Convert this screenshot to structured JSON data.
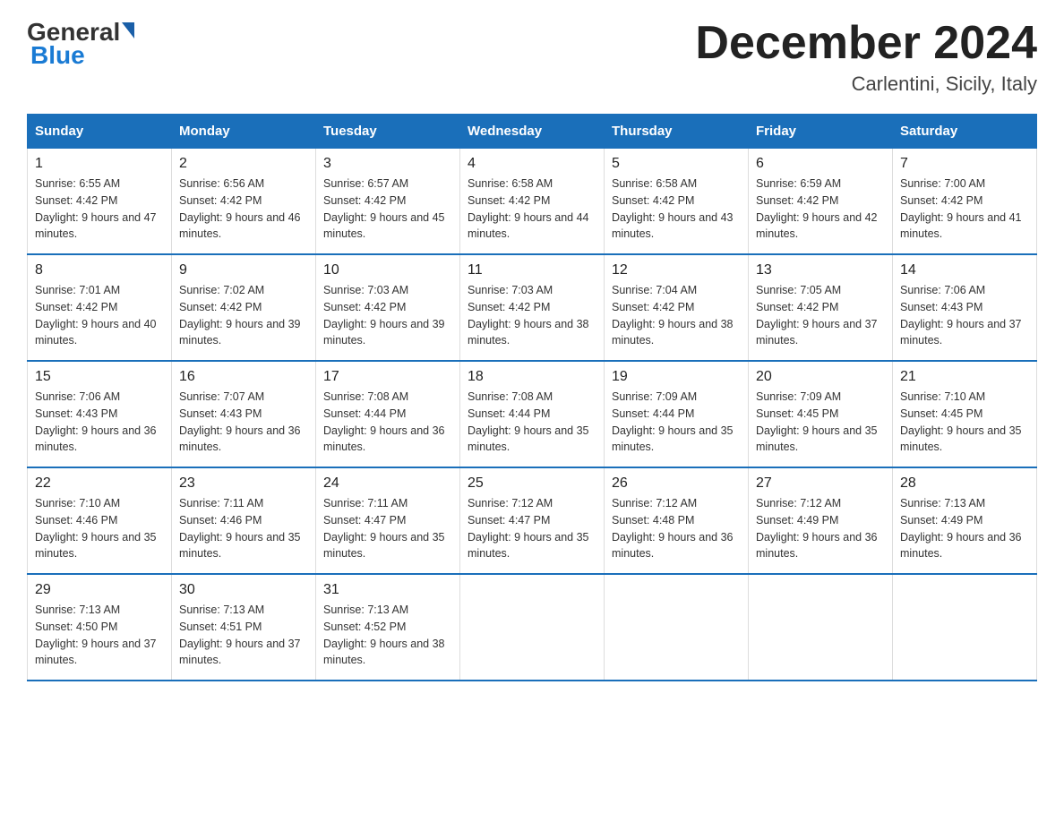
{
  "header": {
    "logo_general": "General",
    "logo_blue": "Blue",
    "month_title": "December 2024",
    "location": "Carlentini, Sicily, Italy"
  },
  "weekdays": [
    "Sunday",
    "Monday",
    "Tuesday",
    "Wednesday",
    "Thursday",
    "Friday",
    "Saturday"
  ],
  "weeks": [
    [
      {
        "day": "1",
        "sunrise": "Sunrise: 6:55 AM",
        "sunset": "Sunset: 4:42 PM",
        "daylight": "Daylight: 9 hours and 47 minutes."
      },
      {
        "day": "2",
        "sunrise": "Sunrise: 6:56 AM",
        "sunset": "Sunset: 4:42 PM",
        "daylight": "Daylight: 9 hours and 46 minutes."
      },
      {
        "day": "3",
        "sunrise": "Sunrise: 6:57 AM",
        "sunset": "Sunset: 4:42 PM",
        "daylight": "Daylight: 9 hours and 45 minutes."
      },
      {
        "day": "4",
        "sunrise": "Sunrise: 6:58 AM",
        "sunset": "Sunset: 4:42 PM",
        "daylight": "Daylight: 9 hours and 44 minutes."
      },
      {
        "day": "5",
        "sunrise": "Sunrise: 6:58 AM",
        "sunset": "Sunset: 4:42 PM",
        "daylight": "Daylight: 9 hours and 43 minutes."
      },
      {
        "day": "6",
        "sunrise": "Sunrise: 6:59 AM",
        "sunset": "Sunset: 4:42 PM",
        "daylight": "Daylight: 9 hours and 42 minutes."
      },
      {
        "day": "7",
        "sunrise": "Sunrise: 7:00 AM",
        "sunset": "Sunset: 4:42 PM",
        "daylight": "Daylight: 9 hours and 41 minutes."
      }
    ],
    [
      {
        "day": "8",
        "sunrise": "Sunrise: 7:01 AM",
        "sunset": "Sunset: 4:42 PM",
        "daylight": "Daylight: 9 hours and 40 minutes."
      },
      {
        "day": "9",
        "sunrise": "Sunrise: 7:02 AM",
        "sunset": "Sunset: 4:42 PM",
        "daylight": "Daylight: 9 hours and 39 minutes."
      },
      {
        "day": "10",
        "sunrise": "Sunrise: 7:03 AM",
        "sunset": "Sunset: 4:42 PM",
        "daylight": "Daylight: 9 hours and 39 minutes."
      },
      {
        "day": "11",
        "sunrise": "Sunrise: 7:03 AM",
        "sunset": "Sunset: 4:42 PM",
        "daylight": "Daylight: 9 hours and 38 minutes."
      },
      {
        "day": "12",
        "sunrise": "Sunrise: 7:04 AM",
        "sunset": "Sunset: 4:42 PM",
        "daylight": "Daylight: 9 hours and 38 minutes."
      },
      {
        "day": "13",
        "sunrise": "Sunrise: 7:05 AM",
        "sunset": "Sunset: 4:42 PM",
        "daylight": "Daylight: 9 hours and 37 minutes."
      },
      {
        "day": "14",
        "sunrise": "Sunrise: 7:06 AM",
        "sunset": "Sunset: 4:43 PM",
        "daylight": "Daylight: 9 hours and 37 minutes."
      }
    ],
    [
      {
        "day": "15",
        "sunrise": "Sunrise: 7:06 AM",
        "sunset": "Sunset: 4:43 PM",
        "daylight": "Daylight: 9 hours and 36 minutes."
      },
      {
        "day": "16",
        "sunrise": "Sunrise: 7:07 AM",
        "sunset": "Sunset: 4:43 PM",
        "daylight": "Daylight: 9 hours and 36 minutes."
      },
      {
        "day": "17",
        "sunrise": "Sunrise: 7:08 AM",
        "sunset": "Sunset: 4:44 PM",
        "daylight": "Daylight: 9 hours and 36 minutes."
      },
      {
        "day": "18",
        "sunrise": "Sunrise: 7:08 AM",
        "sunset": "Sunset: 4:44 PM",
        "daylight": "Daylight: 9 hours and 35 minutes."
      },
      {
        "day": "19",
        "sunrise": "Sunrise: 7:09 AM",
        "sunset": "Sunset: 4:44 PM",
        "daylight": "Daylight: 9 hours and 35 minutes."
      },
      {
        "day": "20",
        "sunrise": "Sunrise: 7:09 AM",
        "sunset": "Sunset: 4:45 PM",
        "daylight": "Daylight: 9 hours and 35 minutes."
      },
      {
        "day": "21",
        "sunrise": "Sunrise: 7:10 AM",
        "sunset": "Sunset: 4:45 PM",
        "daylight": "Daylight: 9 hours and 35 minutes."
      }
    ],
    [
      {
        "day": "22",
        "sunrise": "Sunrise: 7:10 AM",
        "sunset": "Sunset: 4:46 PM",
        "daylight": "Daylight: 9 hours and 35 minutes."
      },
      {
        "day": "23",
        "sunrise": "Sunrise: 7:11 AM",
        "sunset": "Sunset: 4:46 PM",
        "daylight": "Daylight: 9 hours and 35 minutes."
      },
      {
        "day": "24",
        "sunrise": "Sunrise: 7:11 AM",
        "sunset": "Sunset: 4:47 PM",
        "daylight": "Daylight: 9 hours and 35 minutes."
      },
      {
        "day": "25",
        "sunrise": "Sunrise: 7:12 AM",
        "sunset": "Sunset: 4:47 PM",
        "daylight": "Daylight: 9 hours and 35 minutes."
      },
      {
        "day": "26",
        "sunrise": "Sunrise: 7:12 AM",
        "sunset": "Sunset: 4:48 PM",
        "daylight": "Daylight: 9 hours and 36 minutes."
      },
      {
        "day": "27",
        "sunrise": "Sunrise: 7:12 AM",
        "sunset": "Sunset: 4:49 PM",
        "daylight": "Daylight: 9 hours and 36 minutes."
      },
      {
        "day": "28",
        "sunrise": "Sunrise: 7:13 AM",
        "sunset": "Sunset: 4:49 PM",
        "daylight": "Daylight: 9 hours and 36 minutes."
      }
    ],
    [
      {
        "day": "29",
        "sunrise": "Sunrise: 7:13 AM",
        "sunset": "Sunset: 4:50 PM",
        "daylight": "Daylight: 9 hours and 37 minutes."
      },
      {
        "day": "30",
        "sunrise": "Sunrise: 7:13 AM",
        "sunset": "Sunset: 4:51 PM",
        "daylight": "Daylight: 9 hours and 37 minutes."
      },
      {
        "day": "31",
        "sunrise": "Sunrise: 7:13 AM",
        "sunset": "Sunset: 4:52 PM",
        "daylight": "Daylight: 9 hours and 38 minutes."
      },
      null,
      null,
      null,
      null
    ]
  ]
}
